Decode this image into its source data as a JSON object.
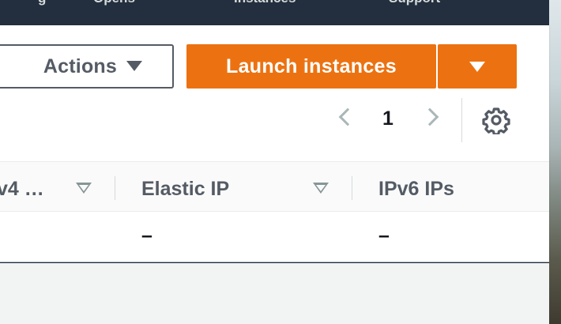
{
  "nav": {
    "items": [
      "g",
      "Opens",
      "Instances",
      "Support"
    ]
  },
  "toolbar": {
    "actions_label": "Actions",
    "launch_label": "Launch instances"
  },
  "pagination": {
    "current_page": "1"
  },
  "table": {
    "headers": [
      "v4 …",
      "Elastic IP",
      "IPv6 IPs"
    ],
    "rows": [
      {
        "ipv4": "",
        "elastic_ip": "–",
        "ipv6_ips": "–"
      }
    ]
  },
  "colors": {
    "primary_orange": "#ec7211",
    "nav_dark": "#232f3e",
    "text_gray": "#545b64",
    "text_dark": "#16191f"
  }
}
